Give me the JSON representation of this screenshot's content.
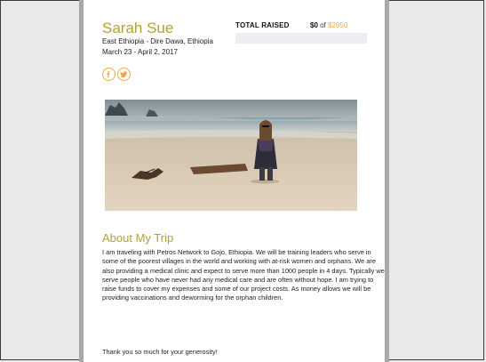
{
  "profile": {
    "name": "Sarah Sue",
    "location": "East Ethiopia - Dire Dawa, Ethiopia",
    "dates": "March 23 - April 2, 2017"
  },
  "fundraising": {
    "label": "TOTAL RAISED",
    "raised": "$0",
    "of_text": " of ",
    "goal": "$2950",
    "progress_fraction": 0
  },
  "social": [
    {
      "icon": "facebook-icon"
    },
    {
      "icon": "twitter-icon"
    }
  ],
  "trip": {
    "heading": "About My Trip",
    "description": "I am traveling with Petros Network to Gojo, Ethiopia. We will be training leaders who serve in some of the poorest villages in the world and working with at-risk women and orphans. We are also providing a medical clinic and expect to serve more than 1000 people in 4 days. Typically we serve people who have never had any medical care and are often without hope. I am trying to raise funds to cover my expenses and some of our project costs. As money allows we will be providing vaccinations and deworming for the orphan children.",
    "thanks": "Thank you so much for your generosity!"
  },
  "colors": {
    "accent_gold": "#b3a233",
    "accent_orange": "#f0a64a",
    "page_bg": "#ffffff",
    "side_bg": "#e9e9e9"
  }
}
